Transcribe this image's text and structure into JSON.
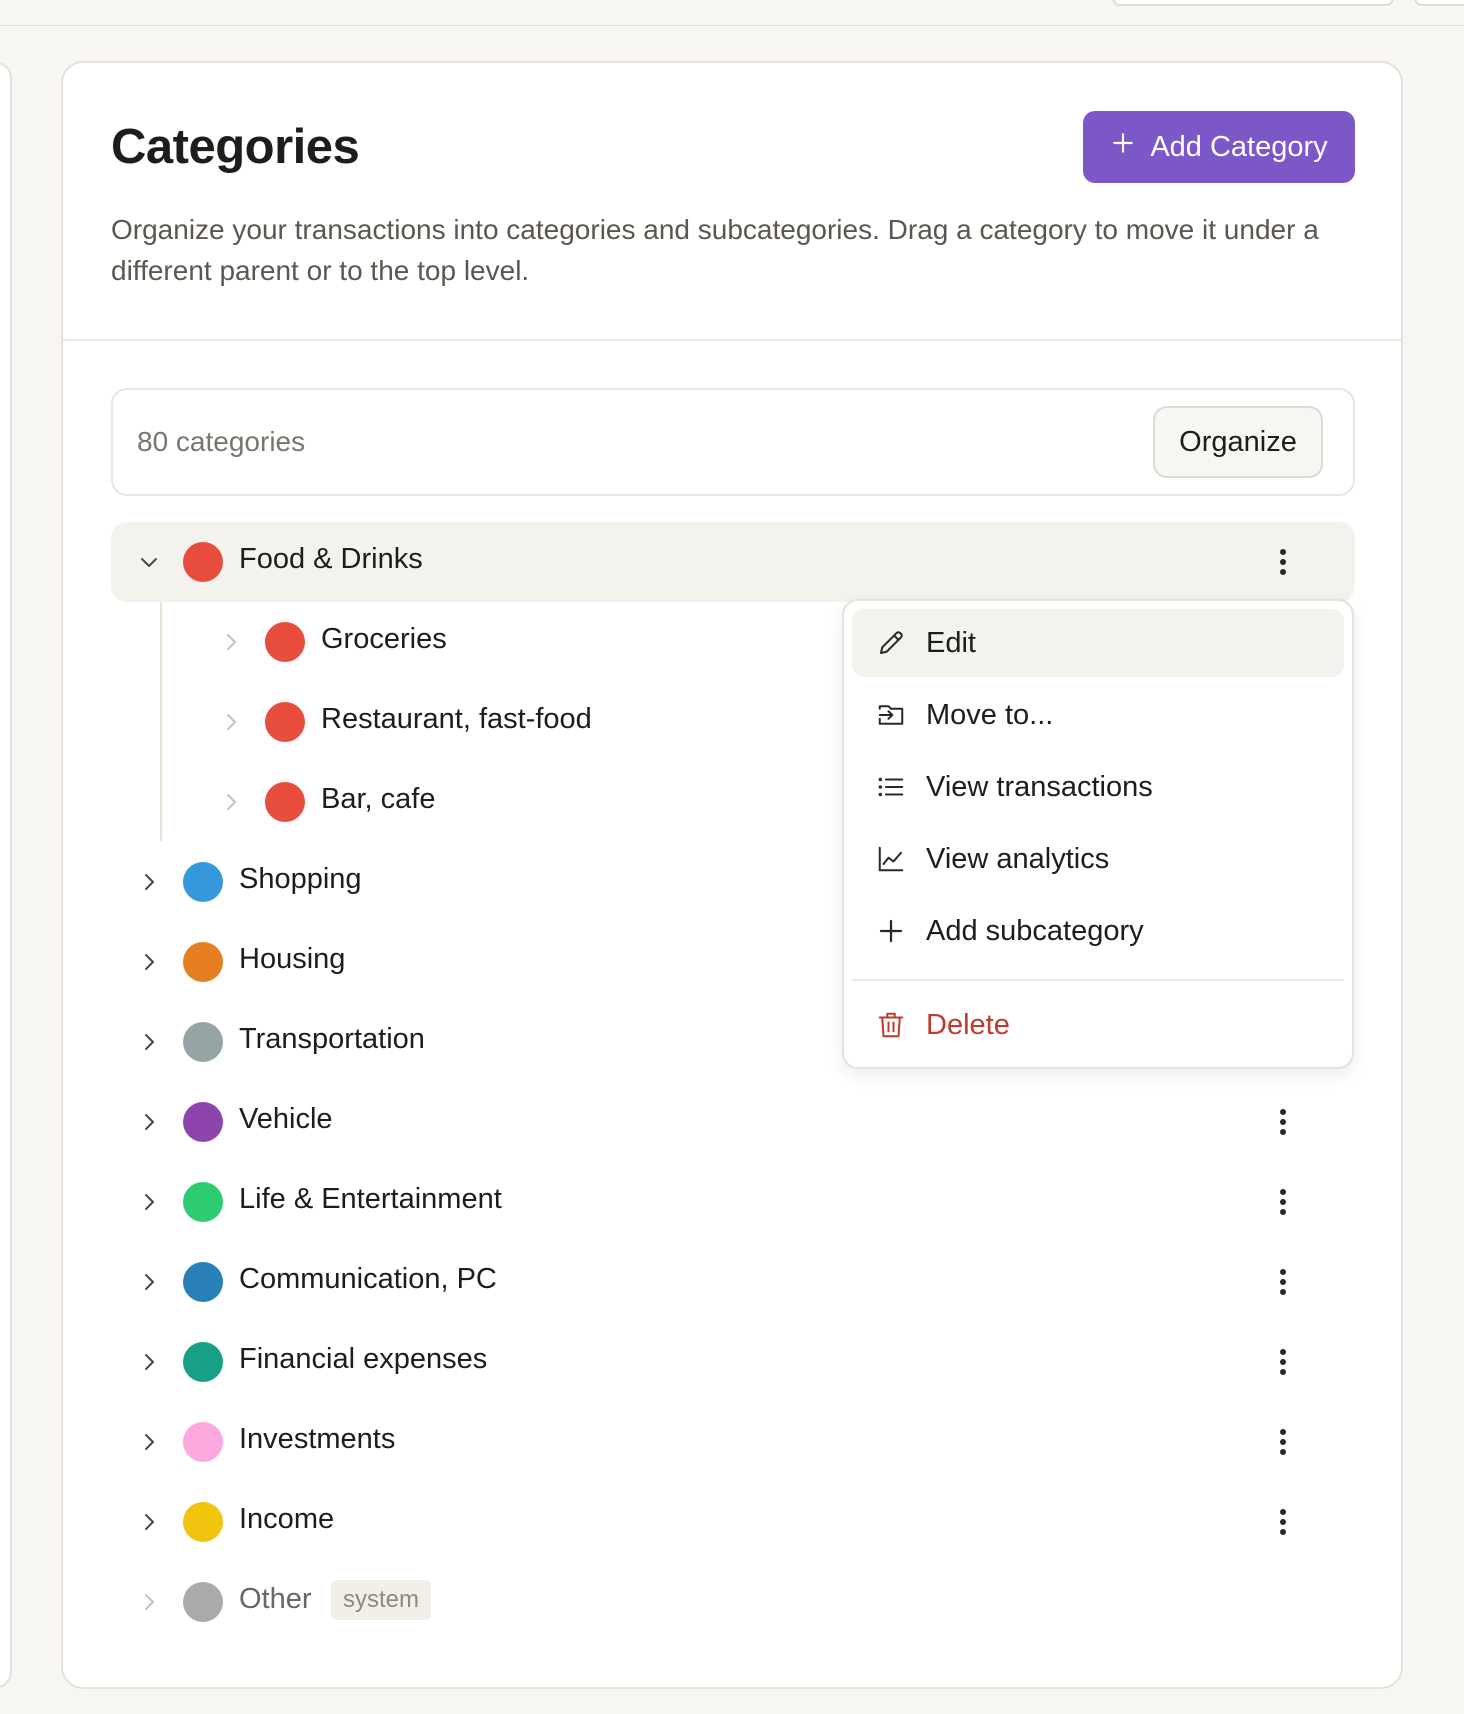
{
  "header": {
    "title": "Categories",
    "add_button_label": "Add Category",
    "description": "Organize your transactions into categories and subcategories. Drag a category to move it under a different parent or to the top level."
  },
  "toolbar": {
    "count_label": "80 categories",
    "organize_label": "Organize"
  },
  "categories": [
    {
      "label": "Food & Drinks",
      "color": "#e74c3c",
      "expanded": true,
      "active": true
    },
    {
      "label": "Groceries",
      "color": "#e74c3c",
      "child": true
    },
    {
      "label": "Restaurant, fast-food",
      "color": "#e74c3c",
      "child": true
    },
    {
      "label": "Bar, cafe",
      "color": "#e74c3c",
      "child": true
    },
    {
      "label": "Shopping",
      "color": "#3498db"
    },
    {
      "label": "Housing",
      "color": "#e67e22"
    },
    {
      "label": "Transportation",
      "color": "#95a5a6"
    },
    {
      "label": "Vehicle",
      "color": "#8e44ad"
    },
    {
      "label": "Life & Entertainment",
      "color": "#2ecc71"
    },
    {
      "label": "Communication, PC",
      "color": "#2980b9"
    },
    {
      "label": "Financial expenses",
      "color": "#16a085"
    },
    {
      "label": "Investments",
      "color": "#fda7df"
    },
    {
      "label": "Income",
      "color": "#f1c40f"
    },
    {
      "label": "Other",
      "color": "#aaaaaa",
      "tag": "system"
    }
  ],
  "context_menu": {
    "items": [
      {
        "label": "Edit",
        "icon": "pencil-icon"
      },
      {
        "label": "Move to...",
        "icon": "folder-move-icon"
      },
      {
        "label": "View transactions",
        "icon": "list-icon"
      },
      {
        "label": "View analytics",
        "icon": "chart-line-icon"
      },
      {
        "label": "Add subcategory",
        "icon": "plus-icon"
      },
      {
        "label": "Delete",
        "icon": "trash-icon",
        "danger": true
      }
    ]
  },
  "colors": {
    "accent": "#7b57c8",
    "danger": "#c0392b"
  }
}
